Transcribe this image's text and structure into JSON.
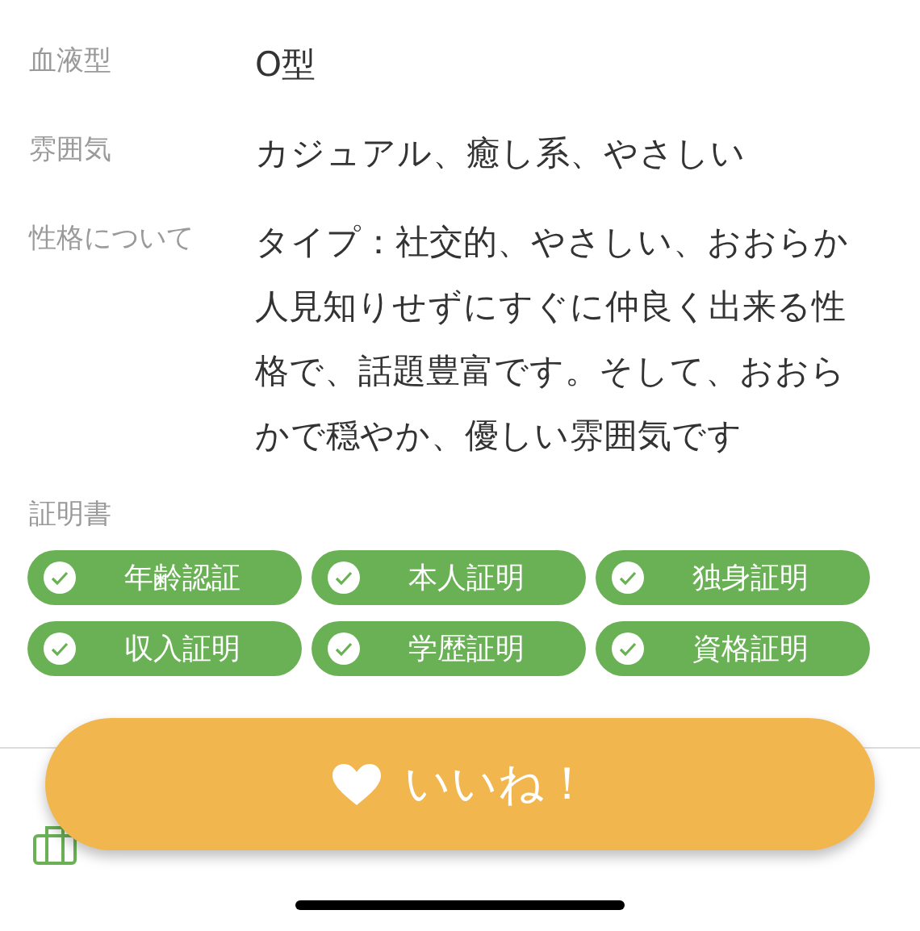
{
  "profile_rows": [
    {
      "label": "血液型",
      "value": "O型"
    },
    {
      "label": "雰囲気",
      "value": "カジュアル、癒し系、やさしい"
    },
    {
      "label": "性格について",
      "value": "タイプ：社交的、やさしい、おおらか人見知りせずにすぐに仲良く出来る性格で、話題豊富です。そして、おおらかで穏やか、優しい雰囲気です"
    }
  ],
  "certificates": {
    "label": "証明書",
    "items": [
      {
        "name": "年齢認証",
        "verified": true
      },
      {
        "name": "本人証明",
        "verified": true
      },
      {
        "name": "独身証明",
        "verified": true
      },
      {
        "name": "収入証明",
        "verified": true
      },
      {
        "name": "学歴証明",
        "verified": true
      },
      {
        "name": "資格証明",
        "verified": true
      }
    ]
  },
  "like_button": {
    "label": "いいね！"
  }
}
